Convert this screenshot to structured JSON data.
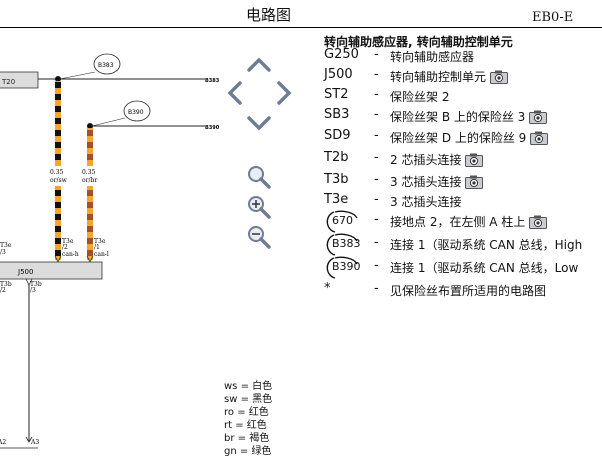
{
  "header": {
    "title": "电路图",
    "doc_code": "EB0-E"
  },
  "toolbar": {
    "buttons": [
      "up-arrow-icon",
      "left-arrow-icon",
      "right-arrow-icon",
      "down-arrow-icon",
      "zoom-fit-icon",
      "zoom-in-icon",
      "zoom-out-icon"
    ]
  },
  "diagram": {
    "bubble_b383": "B383",
    "bubble_b390": "B390",
    "wire1_end": "B383",
    "wire2_end": "B390",
    "left_box_label": "J500",
    "top_left_box_label": "T20",
    "wire_a_size": "0.35",
    "wire_a_color": "or/sw",
    "wire_b_size": "0.35",
    "wire_b_color": "or/br",
    "pin_a_top": "T3e",
    "pin_a_bottom": "/2",
    "pin_a_signal": "can-h",
    "pin_b_top": "T3e",
    "pin_b_bottom": "/1",
    "pin_b_signal": "can-l",
    "left_pin_label": "T3e",
    "left_pin_sub": "/3",
    "box_bottom_left": "T3b",
    "box_bottom_left_sub": "/2",
    "box_bottom_pin": "T3b",
    "box_bottom_pin_sub": "/3",
    "bottom_a2": "A2",
    "bottom_a3": "A3"
  },
  "legend": {
    "title": "转向辅助感应器, 转向辅助控制单元",
    "items": [
      {
        "code": "G250",
        "desc": "转向辅助感应器",
        "camera": false,
        "ring": false
      },
      {
        "code": "J500",
        "desc": "转向辅助控制单元",
        "camera": true,
        "ring": false
      },
      {
        "code": "ST2",
        "desc": "保险丝架 2",
        "camera": false,
        "ring": false
      },
      {
        "code": "SB3",
        "desc": "保险丝架 B 上的保险丝 3",
        "camera": true,
        "ring": false
      },
      {
        "code": "SD9",
        "desc": "保险丝架 D 上的保险丝 9",
        "camera": true,
        "ring": false
      },
      {
        "code": "T2b",
        "desc": "2 芯插头连接",
        "camera": true,
        "ring": false
      },
      {
        "code": "T3b",
        "desc": "3 芯插头连接",
        "camera": true,
        "ring": false
      },
      {
        "code": "T3e",
        "desc": "3 芯插头连接",
        "camera": false,
        "ring": false
      },
      {
        "code": "670",
        "desc": "接地点 2，在左侧 A 柱上",
        "camera": true,
        "ring": true
      },
      {
        "code": "B383",
        "desc": "连接 1（驱动系统 CAN 总线，High",
        "camera": false,
        "ring": true
      },
      {
        "code": "B390",
        "desc": "连接 1（驱动系统 CAN 总线，Low",
        "camera": false,
        "ring": true
      },
      {
        "code": "*",
        "desc": "见保险丝布置所适用的电路图",
        "camera": false,
        "ring": false
      }
    ]
  },
  "color_codes": [
    {
      "abbr": "ws",
      "name": "白色"
    },
    {
      "abbr": "sw",
      "name": "黑色"
    },
    {
      "abbr": "ro",
      "name": "红色"
    },
    {
      "abbr": "rt",
      "name": "红色"
    },
    {
      "abbr": "br",
      "name": "褐色"
    },
    {
      "abbr": "gn",
      "name": "绿色"
    }
  ],
  "colors": {
    "wire_orange": "#f5a623",
    "wire_black": "#111111",
    "wire_brown": "#a0522d",
    "box_fill": "#dcdcdc",
    "nav_icon": "#6e7d95"
  }
}
